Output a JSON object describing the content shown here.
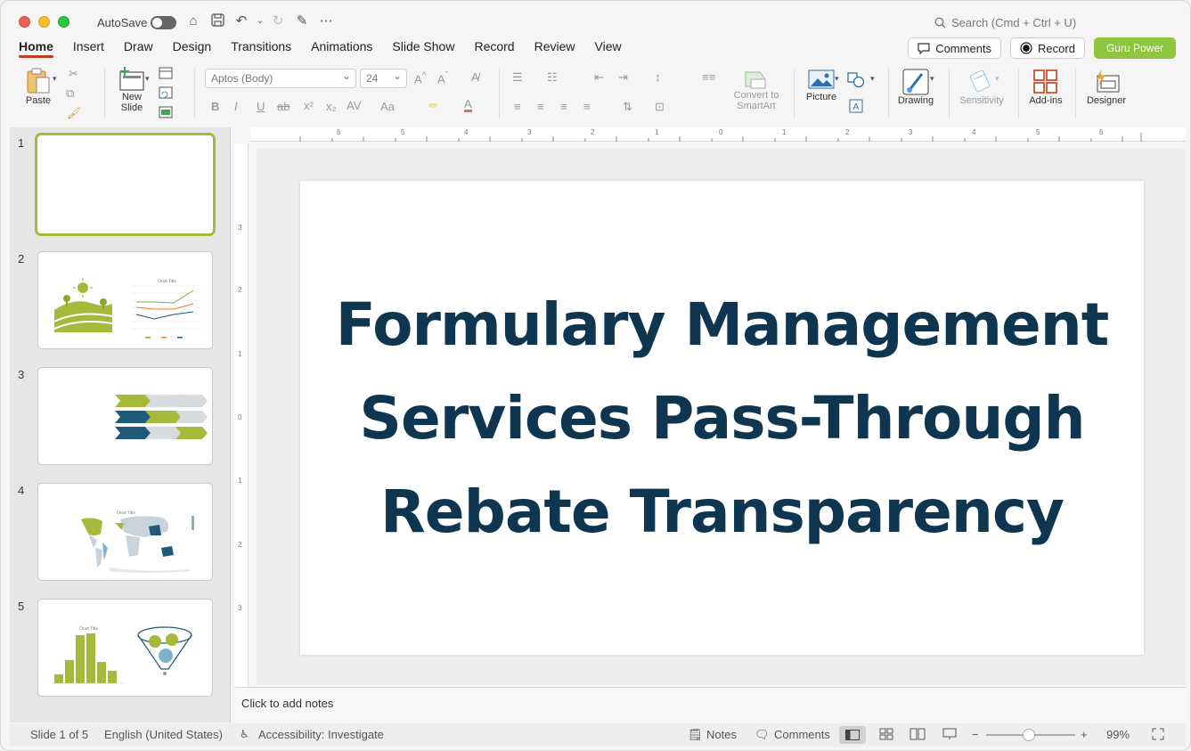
{
  "titlebar": {
    "autosave_label": "AutoSave",
    "search_placeholder": "Search (Cmd + Ctrl + U)"
  },
  "tabs": [
    {
      "label": "Home",
      "active": true
    },
    {
      "label": "Insert"
    },
    {
      "label": "Draw"
    },
    {
      "label": "Design"
    },
    {
      "label": "Transitions"
    },
    {
      "label": "Animations"
    },
    {
      "label": "Slide Show"
    },
    {
      "label": "Record"
    },
    {
      "label": "Review"
    },
    {
      "label": "View"
    }
  ],
  "header_buttons": {
    "comments": "Comments",
    "record": "Record",
    "guru": "Guru Power"
  },
  "ribbon": {
    "paste": "Paste",
    "new_slide_line1": "New",
    "new_slide_line2": "Slide",
    "font_name": "Aptos (Body)",
    "font_size": "24",
    "convert_line1": "Convert to",
    "convert_line2": "SmartArt",
    "picture": "Picture",
    "drawing": "Drawing",
    "sensitivity": "Sensitivity",
    "addins": "Add-ins",
    "designer": "Designer"
  },
  "slides": [
    {
      "num": "1"
    },
    {
      "num": "2"
    },
    {
      "num": "3"
    },
    {
      "num": "4"
    },
    {
      "num": "5"
    }
  ],
  "slide": {
    "title_line1": "Formulary Management",
    "title_line2": "Services Pass-Through",
    "title_line3": "Rebate Transparency"
  },
  "ruler_h": [
    "6",
    "5",
    "4",
    "3",
    "2",
    "1",
    "0",
    "1",
    "2",
    "3",
    "4",
    "5",
    "6"
  ],
  "ruler_v": [
    "3",
    "2",
    "1",
    "0",
    "1",
    "2",
    "3"
  ],
  "notes_placeholder": "Click to add notes",
  "status": {
    "slide_info": "Slide 1 of 5",
    "language": "English (United States)",
    "accessibility": "Accessibility: Investigate",
    "notes": "Notes",
    "comments": "Comments",
    "zoom": "99%"
  },
  "colors": {
    "accent": "#c43e1c",
    "title": "#0e3650",
    "guru": "#8dc63f",
    "slide_green": "#a6b93a"
  }
}
